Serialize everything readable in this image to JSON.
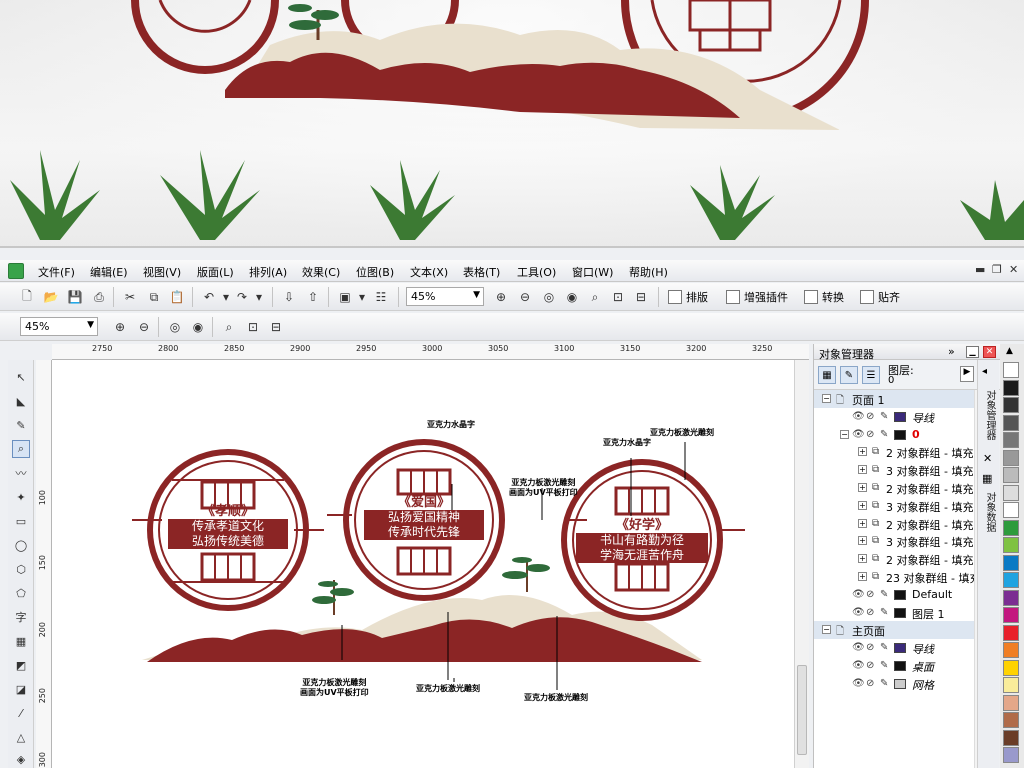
{
  "menubar": {
    "items": [
      "文件(F)",
      "编辑(E)",
      "视图(V)",
      "版面(L)",
      "排列(A)",
      "效果(C)",
      "位图(B)",
      "文本(X)",
      "表格(T)",
      "工具(O)",
      "窗口(W)",
      "帮助(H)"
    ]
  },
  "toolbar1": {
    "zoom": "45%",
    "buttons": [
      "排版",
      "增强插件",
      "转换",
      "贴齐"
    ]
  },
  "toolbar2": {
    "zoom": "45%"
  },
  "ruler_h": {
    "ticks": [
      "2750",
      "2800",
      "2850",
      "2900",
      "2950",
      "3000",
      "3050",
      "3100",
      "3150",
      "3200",
      "3250"
    ]
  },
  "ruler_v": {
    "ticks": [
      "100",
      "150",
      "200",
      "250",
      "300"
    ]
  },
  "canvas": {
    "circles": [
      {
        "title": "《孝顺》",
        "line1": "传承孝道文化",
        "line2": "弘扬传统美德"
      },
      {
        "title": "《爱国》",
        "line1": "弘扬爱国精神",
        "line2": "传承时代先锋"
      },
      {
        "title": "《好学》",
        "line1": "书山有路勤为径",
        "line2": "学海无涯苦作舟"
      }
    ],
    "callouts": {
      "c1": "亚克力水晶字",
      "c2": "亚克力板激光雕刻",
      "c3": "亚克力水晶字",
      "c4a": "亚克力板激光雕刻",
      "c4b": "画面为UV平板打印",
      "c5a": "亚克力板激光雕刻",
      "c5b": "画面为UV平板打印",
      "c6": "亚克力板激光雕刻",
      "c7": "亚克力板激光雕刻"
    },
    "colors": {
      "maroon": "#8b2525",
      "beige": "#e9e0ce",
      "green": "#2f6b3a"
    }
  },
  "panel": {
    "title": "对象管理器",
    "layer_label": "图层:",
    "layer_value": "0",
    "rows": [
      {
        "type": "section",
        "label": "页面 1"
      },
      {
        "type": "sub",
        "label": "导线",
        "italic": true,
        "color": "#3a2a7a"
      },
      {
        "type": "sub",
        "label": "0",
        "red": true,
        "color": "#111111"
      },
      {
        "type": "group",
        "label": "2 对象群组 - 填充"
      },
      {
        "type": "group",
        "label": "3 对象群组 - 填充"
      },
      {
        "type": "group",
        "label": "2 对象群组 - 填充"
      },
      {
        "type": "group",
        "label": "3 对象群组 - 填充"
      },
      {
        "type": "group",
        "label": "2 对象群组 - 填充"
      },
      {
        "type": "group",
        "label": "3 对象群组 - 填充"
      },
      {
        "type": "group",
        "label": "2 对象群组 - 填充"
      },
      {
        "type": "group",
        "label": "23 对象群组 - 填充"
      },
      {
        "type": "sub",
        "label": "Default",
        "color": "#111111"
      },
      {
        "type": "sub",
        "label": "图层 1",
        "color": "#111111"
      },
      {
        "type": "section",
        "label": "主页面"
      },
      {
        "type": "sub",
        "label": "导线",
        "italic": true,
        "color": "#3a2a7a"
      },
      {
        "type": "sub",
        "label": "桌面",
        "italic": true,
        "color": "#111111"
      },
      {
        "type": "sub",
        "label": "网格",
        "italic": true,
        "color": "#cccccc"
      }
    ]
  },
  "side_tabs": {
    "tab1": "对象管理器",
    "tab2": "对象数据"
  },
  "palette": [
    "#ffffff",
    "#1a1a1a",
    "#333333",
    "#555555",
    "#777777",
    "#999999",
    "#bbbbbb",
    "#dddddd",
    "#ffffff",
    "#2e9b3b",
    "#7fc241",
    "#0a7ac4",
    "#1fa3e0",
    "#7b2d91",
    "#c3177e",
    "#e8202a",
    "#f07e23",
    "#ffd200",
    "#f9ec9a",
    "#e4a789",
    "#b06b49",
    "#6a3d27",
    "#9999cc"
  ]
}
